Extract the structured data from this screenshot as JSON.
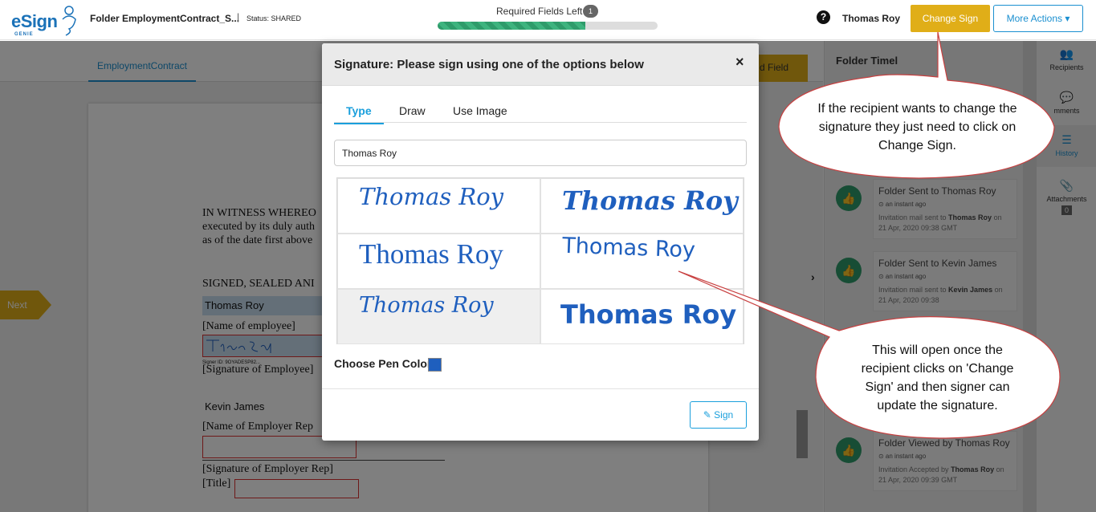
{
  "header": {
    "logo_text": "eSign",
    "logo_sub": "GENIE",
    "folder_name": "Folder EmploymentContract_S...",
    "separator": "|",
    "status": "Status: SHARED",
    "required_label": "Required Fields Left",
    "required_count": "1",
    "progress_fraction": 0.67,
    "help_glyph": "?",
    "user_name": "Thomas Roy",
    "change_sign_label": "Change Sign",
    "more_actions_label": "More Actions ▾"
  },
  "document": {
    "tab_label": "EmploymentContract",
    "next_label": "Next",
    "add_field_label": "d Field",
    "lines": {
      "witness_1": "IN WITNESS WHEREO",
      "witness_2": "executed by its duly auth",
      "witness_3": "as of the date first above",
      "signed_sealed": "SIGNED, SEALED ANI",
      "employee_name_value": "Thomas Roy",
      "name_of_employee": "[Name of employee]",
      "signer_id": "Signer ID: 9OYADESP82...",
      "signature_of_employee": "[Signature of Employee]",
      "employer_name_value": "Kevin James",
      "name_of_employer_rep": "[Name of Employer Rep",
      "signature_of_employer_rep": "[Signature of Employer Rep]",
      "title_label": "[Title]"
    }
  },
  "timeline": {
    "title": "Folder Timel",
    "chevron": "›",
    "items": [
      {
        "title": "Folder Sent to Thomas Roy",
        "time": "⊙ an instant ago",
        "desc_pre": "Invitation mail sent to ",
        "desc_bold": "Thomas Roy",
        "desc_post": " on 21 Apr, 2020 09:38 GMT"
      },
      {
        "title": "Folder Sent to Kevin James",
        "time": "⊙ an instant ago",
        "desc_pre": "Invitation mail sent to ",
        "desc_bold": "Kevin James",
        "desc_post": " on 21 Apr, 2020 09:38"
      },
      {
        "title": "Folder Viewed by Thomas Roy",
        "time": "⊙ an instant ago",
        "desc_pre": "Invitation Accepted by ",
        "desc_bold": "Thomas Roy",
        "desc_post": " on 21 Apr, 2020 09:39 GMT"
      }
    ]
  },
  "sidebar": {
    "recipients": "Recipients",
    "comments": "mments",
    "history": "History",
    "attachments": "Attachments",
    "attachments_count": "0"
  },
  "modal": {
    "title": "Signature: Please sign using one of the options below",
    "close_glyph": "×",
    "tabs": [
      "Type",
      "Draw",
      "Use Image"
    ],
    "name_value": "Thomas Roy",
    "signature_text": "Thomas Roy",
    "pen_color_label": "Choose Pen Color",
    "pen_color": "#1f5fbe",
    "sign_label": "Sign"
  },
  "callouts": {
    "top": "If the recipient wants to change the signature they just need to click on Change Sign.",
    "bottom": "This will open once the recipient clicks on 'Change Sign' and then signer can update the signature."
  },
  "colors": {
    "accent": "#1a9fdc",
    "change_sign_bg": "#e0ae18",
    "timeline_green": "#2e9b6a"
  }
}
